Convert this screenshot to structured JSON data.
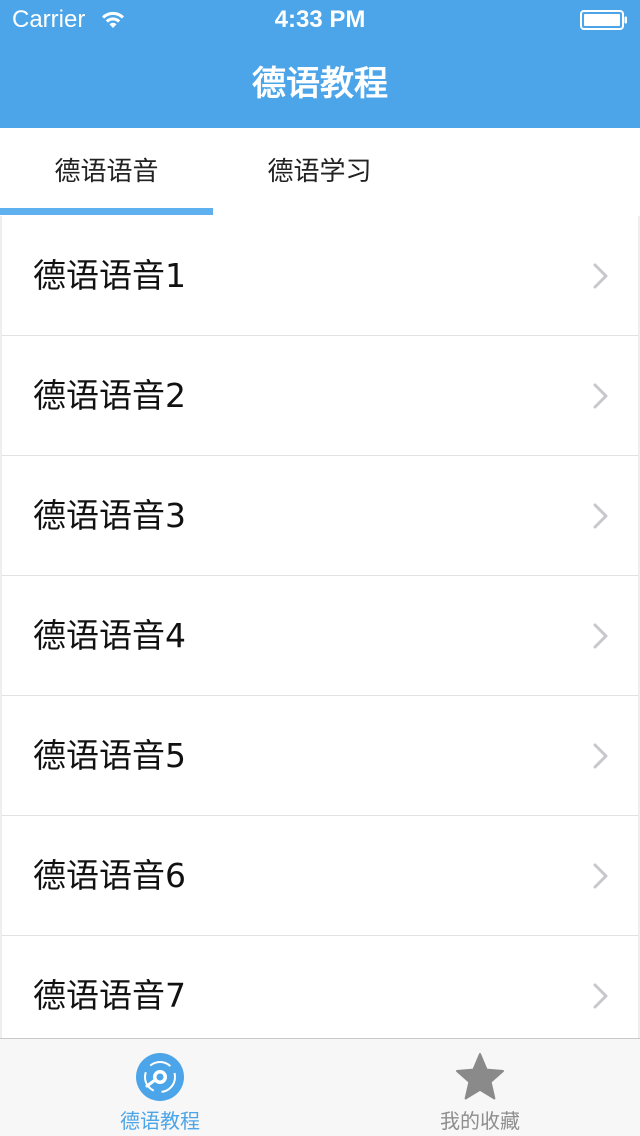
{
  "status_bar": {
    "carrier": "Carrier",
    "time": "4:33 PM",
    "wifi_icon": "wifi-icon",
    "battery_icon": "battery-icon"
  },
  "nav": {
    "title": "德语教程"
  },
  "segments": {
    "items": [
      {
        "label": "德语语音",
        "selected": true
      },
      {
        "label": "德语学习",
        "selected": false
      }
    ],
    "indicator_color": "#5fb0ee"
  },
  "list": {
    "items": [
      {
        "label": "德语语音1"
      },
      {
        "label": "德语语音2"
      },
      {
        "label": "德语语音3"
      },
      {
        "label": "德语语音4"
      },
      {
        "label": "德语语音5"
      },
      {
        "label": "德语语音6"
      },
      {
        "label": "德语语音7"
      }
    ],
    "chevron_icon": "chevron-right-icon"
  },
  "tabbar": {
    "items": [
      {
        "label": "德语教程",
        "icon": "disc-icon",
        "selected": true
      },
      {
        "label": "我的收藏",
        "icon": "star-icon",
        "selected": false
      }
    ]
  },
  "colors": {
    "header_bg": "#4ca5e8",
    "accent": "#4ca5e8",
    "tab_inactive": "#8e8e8e",
    "chevron": "#c7c7cc"
  }
}
